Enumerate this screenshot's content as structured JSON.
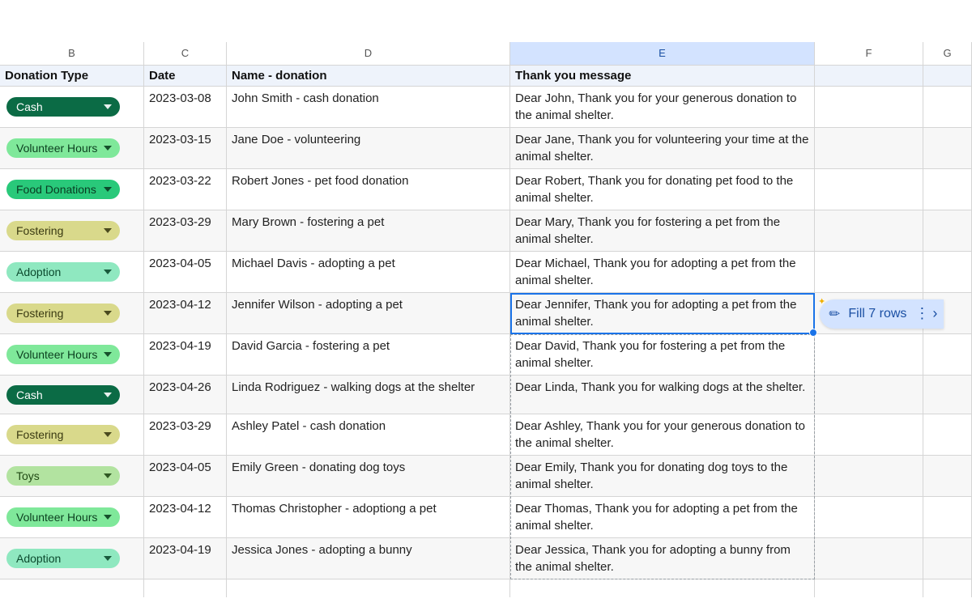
{
  "columns": [
    "B",
    "C",
    "D",
    "E",
    "F",
    "G"
  ],
  "selected_column_index": 3,
  "field_headers": [
    "Donation Type",
    "Date",
    "Name - donation",
    "Thank you message"
  ],
  "rows": [
    {
      "chip_class": "cash",
      "type": "Cash",
      "date": "2023-03-08",
      "name": "John Smith - cash donation",
      "msg": "Dear John, Thank you for your generous donation to the animal shelter."
    },
    {
      "chip_class": "volunteer-hours",
      "type": "Volunteer Hours",
      "date": "2023-03-15",
      "name": "Jane Doe - volunteering",
      "msg": "Dear Jane, Thank you for volunteering your time at the animal shelter."
    },
    {
      "chip_class": "food-donations",
      "type": "Food Donations",
      "date": "2023-03-22",
      "name": "Robert Jones - pet food donation",
      "msg": "Dear Robert, Thank you for donating pet food to the animal shelter."
    },
    {
      "chip_class": "fostering",
      "type": "Fostering",
      "date": "2023-03-29",
      "name": "Mary Brown - fostering a pet",
      "msg": "Dear Mary, Thank you for fostering a pet from the animal shelter."
    },
    {
      "chip_class": "adoption",
      "type": "Adoption",
      "date": "2023-04-05",
      "name": "Michael Davis - adopting a pet",
      "msg": "Dear Michael, Thank you for adopting a pet from the animal shelter."
    },
    {
      "chip_class": "fostering",
      "type": "Fostering",
      "date": "2023-04-12",
      "name": "Jennifer Wilson - adopting a pet",
      "msg": "Dear Jennifer, Thank you for adopting a pet from the animal shelter."
    },
    {
      "chip_class": "volunteer-hours",
      "type": "Volunteer Hours",
      "date": "2023-04-19",
      "name": "David Garcia - fostering a pet",
      "msg": "Dear David, Thank you for fostering a pet from the animal shelter."
    },
    {
      "chip_class": "cash",
      "type": "Cash",
      "date": "2023-04-26",
      "name": "Linda Rodriguez - walking dogs at the shelter",
      "msg": "Dear Linda, Thank you for walking dogs at the shelter."
    },
    {
      "chip_class": "fostering",
      "type": "Fostering",
      "date": "2023-03-29",
      "name": "Ashley Patel - cash donation",
      "msg": "Dear Ashley, Thank you for your generous donation to the animal shelter."
    },
    {
      "chip_class": "toys",
      "type": "Toys",
      "date": "2023-04-05",
      "name": "Emily Green - donating dog toys",
      "msg": "Dear Emily, Thank you for donating dog toys to the animal shelter."
    },
    {
      "chip_class": "volunteer-hours",
      "type": "Volunteer Hours",
      "date": "2023-04-12",
      "name": "Thomas Christopher - adoptiong a pet",
      "msg": "Dear Thomas, Thank you for adopting a pet from the animal shelter."
    },
    {
      "chip_class": "adoption",
      "type": "Adoption",
      "date": "2023-04-19",
      "name": "Jessica Jones - adopting a bunny",
      "msg": "Dear Jessica, Thank you for adopting a bunny from the animal shelter."
    }
  ],
  "smart_fill": {
    "label": "Fill 7 rows"
  },
  "selection": {
    "cell_row_index": 5,
    "preview_start_row": 6,
    "preview_end_row": 11
  }
}
